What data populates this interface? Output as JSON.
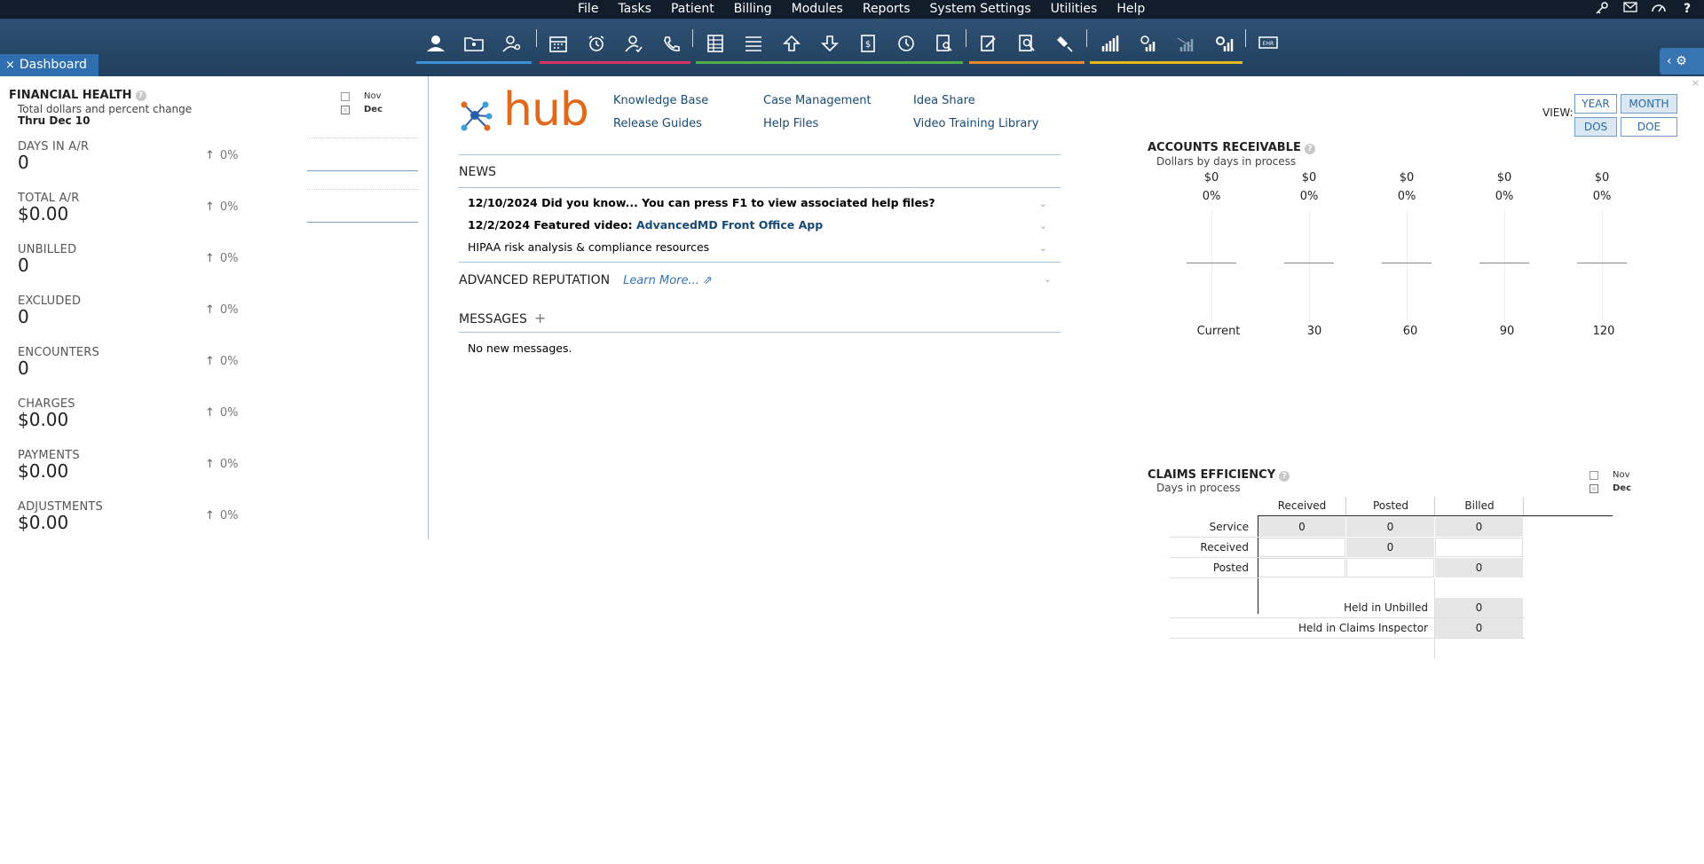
{
  "menu": [
    "File",
    "Tasks",
    "Patient",
    "Billing",
    "Modules",
    "Reports",
    "System Settings",
    "Utilities",
    "Help"
  ],
  "menu_right_icons": [
    "key-icon",
    "mail-icon",
    "speedometer-icon",
    "help-icon"
  ],
  "toolbar_groups": [
    {
      "color": "#3b8fd4",
      "icons": [
        "patient-icon",
        "folder-icon",
        "user-search-icon"
      ]
    },
    {
      "color": "#d8345f",
      "icons": [
        "calendar-icon",
        "alarm-icon",
        "user-check-icon",
        "phone-icon"
      ]
    },
    {
      "color": "#4fb04a",
      "icons": [
        "ledger-icon",
        "list-icon",
        "upload-icon",
        "download-icon",
        "invoice-icon",
        "clock-icon",
        "document-search-icon"
      ]
    },
    {
      "color": "#e98a2a",
      "icons": [
        "edit-doc-icon",
        "report-search-icon",
        "satellite-icon"
      ]
    },
    {
      "color": "#e3b91c",
      "icons": [
        "bar-chart-icon",
        "chart-check-icon",
        "chart-down-icon",
        "chart-gear-icon"
      ]
    },
    {
      "color": "",
      "icons": [
        "ehr-icon"
      ]
    }
  ],
  "tab": {
    "label": "Dashboard",
    "close": "×"
  },
  "financial": {
    "title": "FINANCIAL HEALTH",
    "subtitle": "Total dollars and percent change",
    "thru": "Thru Dec 10",
    "legend": [
      "Nov",
      "Dec"
    ],
    "metrics": [
      {
        "label": "DAYS IN A/R",
        "value": "0",
        "change": "0%"
      },
      {
        "label": "TOTAL A/R",
        "value": "$0.00",
        "change": "0%"
      },
      {
        "label": "UNBILLED",
        "value": "0",
        "change": "0%"
      },
      {
        "label": "EXCLUDED",
        "value": "0",
        "change": "0%"
      },
      {
        "label": "ENCOUNTERS",
        "value": "0",
        "change": "0%"
      },
      {
        "label": "CHARGES",
        "value": "$0.00",
        "change": "0%"
      },
      {
        "label": "PAYMENTS",
        "value": "$0.00",
        "change": "0%"
      },
      {
        "label": "ADJUSTMENTS",
        "value": "$0.00",
        "change": "0%"
      }
    ]
  },
  "hub": {
    "logo_text": "hub",
    "links": [
      "Knowledge Base",
      "Case Management",
      "Idea Share",
      "Release Guides",
      "Help Files",
      "Video Training Library"
    ],
    "news_title": "NEWS",
    "news": [
      {
        "date": "12/10/2024",
        "text": "Did you know... You can press F1 to view associated help files?"
      },
      {
        "date": "12/2/2024",
        "text": "Featured video:",
        "link": "AdvancedMD Front Office App"
      },
      {
        "text": "HIPAA risk analysis & compliance resources"
      }
    ],
    "reputation_title": "ADVANCED REPUTATION",
    "learn_more": "Learn More...",
    "messages_title": "MESSAGES",
    "messages_empty": "No new messages."
  },
  "view": {
    "label": "VIEW:",
    "buttons": [
      "YEAR",
      "MONTH",
      "DOS",
      "DOE"
    ],
    "active": [
      "MONTH",
      "DOS"
    ]
  },
  "ar": {
    "title": "ACCOUNTS RECEIVABLE",
    "subtitle": "Dollars by days in process",
    "columns": [
      {
        "amount": "$0",
        "pct": "0%",
        "cat": "Current"
      },
      {
        "amount": "$0",
        "pct": "0%",
        "cat": "30"
      },
      {
        "amount": "$0",
        "pct": "0%",
        "cat": "60"
      },
      {
        "amount": "$0",
        "pct": "0%",
        "cat": "90"
      },
      {
        "amount": "$0",
        "pct": "0%",
        "cat": "120"
      }
    ]
  },
  "claims": {
    "title": "CLAIMS EFFICIENCY",
    "subtitle": "Days in process",
    "legend": [
      "Nov",
      "Dec"
    ],
    "headers": [
      "Received",
      "Posted",
      "Billed"
    ],
    "rows": [
      "Service",
      "Received",
      "Posted"
    ],
    "values": {
      "service": [
        "0",
        "0",
        "0"
      ],
      "received_posted": "0",
      "posted_billed": "0"
    },
    "held": [
      {
        "label": "Held in Unbilled",
        "value": "0"
      },
      {
        "label": "Held in Claims Inspector",
        "value": "0"
      }
    ]
  }
}
